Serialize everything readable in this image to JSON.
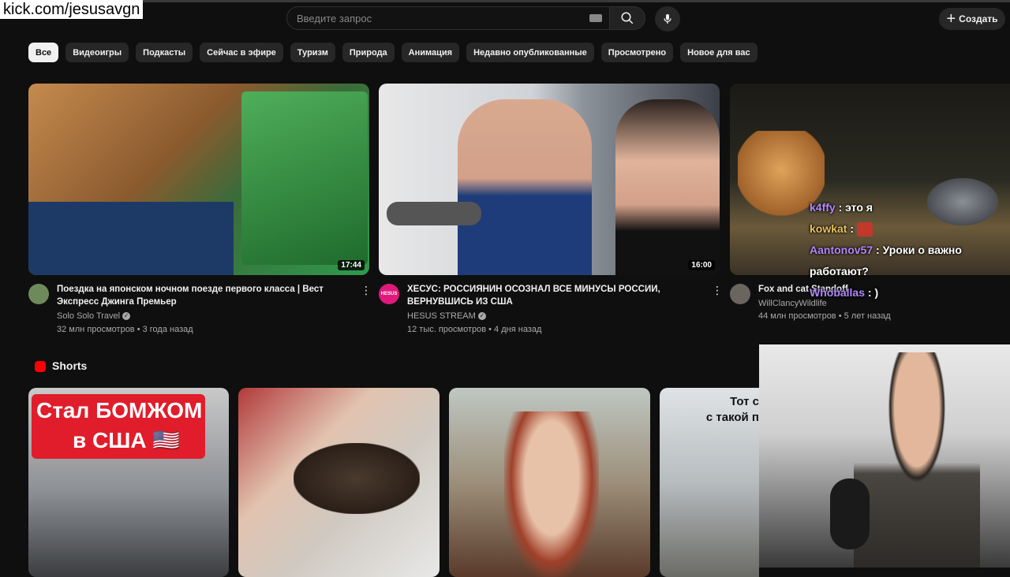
{
  "overlay": {
    "url": "kick.com/jesusavgn"
  },
  "search": {
    "placeholder": "Введите запрос"
  },
  "header": {
    "create_label": "Создать"
  },
  "chips": [
    "Все",
    "Видеоигры",
    "Подкасты",
    "Сейчас в эфире",
    "Туризм",
    "Природа",
    "Анимация",
    "Недавно опубликованные",
    "Просмотрено",
    "Новое для вас"
  ],
  "videos": [
    {
      "title_line1": "Поездка на японском ночном поезде первого класса | Вест",
      "title_line2": "Экспресс Джинга Премьер",
      "channel": "Solo Solo Travel",
      "meta": "32 млн просмотров • 3 года назад",
      "duration": "17:44"
    },
    {
      "title_line1": "ХЕСУС: РОССИЯНИН ОСОЗНАЛ ВСЕ МИНУСЫ РОССИИ,",
      "title_line2": "ВЕРНУВШИСЬ ИЗ США",
      "channel": "HESUS STREAM",
      "meta": "12 тыс. просмотров • 4 дня назад",
      "duration": "16:00",
      "avatar_text": "HESUS"
    },
    {
      "title_line1": "Fox and cat Standoff",
      "channel": "WillClancyWildlife",
      "meta": "44 млн просмотров • 5 лет назад"
    }
  ],
  "chat": [
    {
      "user": "k4ffy",
      "text": ": это я"
    },
    {
      "user": "kowkat",
      "text": ":"
    },
    {
      "user": "Aantonov57",
      "text": ": Уроки о важно",
      "text2": "работают?"
    },
    {
      "user": "Whoballas",
      "text": ": )"
    }
  ],
  "shorts": {
    "title": "Shorts",
    "short1_text_line1": "Стал БОМЖОМ",
    "short1_text_line2": "в США 🇺🇸",
    "short4_text_line1": "Тот с",
    "short4_text_line2": "с такой п"
  }
}
